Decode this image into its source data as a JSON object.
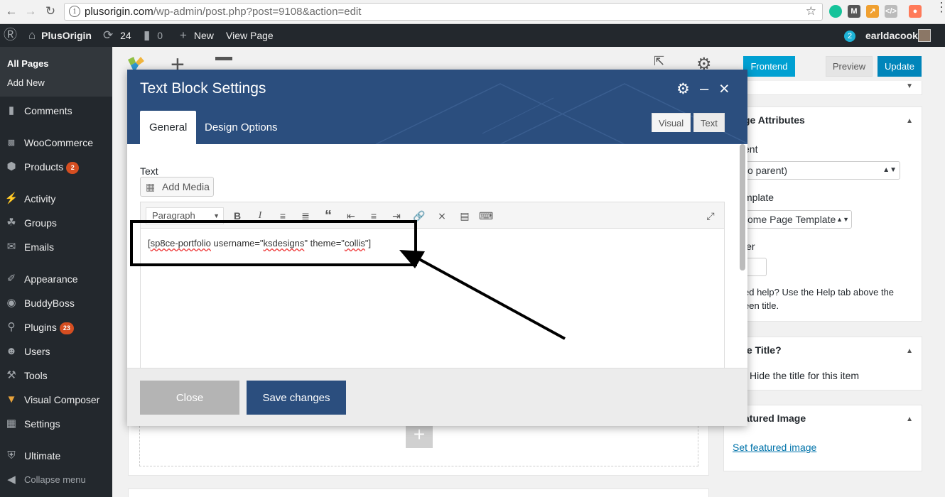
{
  "browser": {
    "url_domain": "plusorigin.com",
    "url_rest": "/wp-admin/post.php?post=9108&action=edit",
    "extensions": [
      "grammarly-icon",
      "m-icon",
      "chart-icon",
      "code-icon",
      "hubspot-icon"
    ]
  },
  "adminbar": {
    "site_name": "PlusOrigin",
    "updates": "24",
    "comments": "0",
    "new_label": "New",
    "view_page": "View Page",
    "notifications": "2",
    "user": "earldacook"
  },
  "sidebar": {
    "sub_all_pages": "All Pages",
    "sub_add_new": "Add New",
    "items": [
      {
        "label": "Comments",
        "icon": "comments-icon"
      },
      {
        "label": "WooCommerce",
        "icon": "woocommerce-icon"
      },
      {
        "label": "Products",
        "icon": "products-icon",
        "count": "2"
      },
      {
        "label": "Activity",
        "icon": "activity-icon"
      },
      {
        "label": "Groups",
        "icon": "groups-icon"
      },
      {
        "label": "Emails",
        "icon": "emails-icon"
      },
      {
        "label": "Appearance",
        "icon": "appearance-icon"
      },
      {
        "label": "BuddyBoss",
        "icon": "buddyboss-icon"
      },
      {
        "label": "Plugins",
        "icon": "plugins-icon",
        "count": "23"
      },
      {
        "label": "Users",
        "icon": "users-icon"
      },
      {
        "label": "Tools",
        "icon": "tools-icon"
      },
      {
        "label": "Visual Composer",
        "icon": "visual-composer-icon"
      },
      {
        "label": "Settings",
        "icon": "settings-icon"
      },
      {
        "label": "Ultimate",
        "icon": "ultimate-icon"
      },
      {
        "label": "Collapse menu",
        "icon": "collapse-icon"
      }
    ]
  },
  "toolbar": {
    "frontend": "Frontend",
    "preview": "Preview",
    "update": "Update"
  },
  "page_attributes": {
    "title": "ge Attributes",
    "parent_label": "ent",
    "parent_value": "o parent)",
    "template_label": "mplate",
    "template_value": "ome Page Template",
    "order_label": "ler",
    "help_line1": "ed help? Use the Help tab above the",
    "help_line2": "een title."
  },
  "hide_title": {
    "title": "le Title?",
    "option": "Hide the title for this item"
  },
  "featured": {
    "title": "atured Image",
    "link": "Set featured image"
  },
  "modal": {
    "title": "Text Block Settings",
    "tabs": [
      "General",
      "Design Options"
    ],
    "field_label": "Text",
    "add_media": "Add Media",
    "mode_visual": "Visual",
    "mode_text": "Text",
    "format": "Paragraph",
    "content_pre": "[",
    "content_sp": "sp8ce-portfolio",
    "content_mid": " username=\"",
    "content_user": "ksdesigns",
    "content_mid2": "\" theme=\"",
    "content_theme": "collis",
    "content_post": "\"]",
    "close": "Close",
    "save": "Save changes"
  },
  "colors": {
    "admin_dark": "#23282d",
    "modal_blue": "#2b4e7e",
    "wp_blue": "#0085ba",
    "frontend_blue": "#00a0d2",
    "badge_orange": "#d54e21"
  }
}
